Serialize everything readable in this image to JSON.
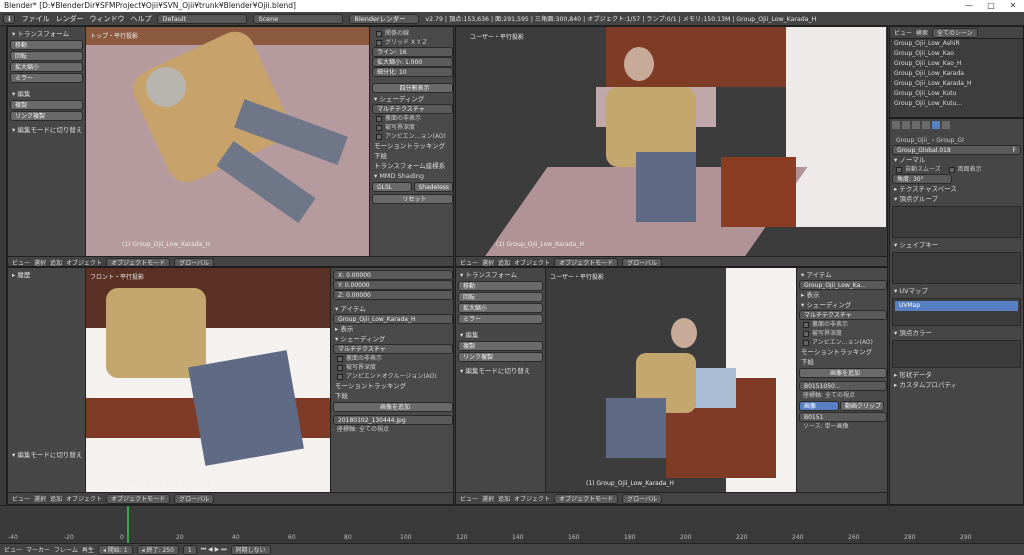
{
  "titlebar": {
    "text": "Blender* [D:¥BlenderDir¥SFMProject¥Ojii¥SVN_Ojii¥trunk¥Blender¥Ojii.blend]",
    "min": "—",
    "max": "□",
    "close": "✕"
  },
  "infobar": {
    "menus": [
      "ファイル",
      "レンダー",
      "ウィンドウ",
      "ヘルプ"
    ],
    "screen": "Default",
    "scene": "Scene",
    "engine": "Blenderレンダー",
    "stats": "v2.79 | 頂点:153,636 | 面:291,595 | 三角面:300,840 | オブジェクト:1/57 | ランプ:0/1 | メモリ:150.13M | Group_Ojii_Low_Karada_H"
  },
  "tl_view": {
    "title": "トップ・平行投影",
    "label": "(1) Group_Ojii_Low_Karada_H"
  },
  "tr_view": {
    "title": "ユーザー・平行投影",
    "label": "(1) Group_Ojii_Low_Karada_H"
  },
  "bl_view": {
    "title": "フロント・平行投影",
    "label": "(1) Group_Ojii_Low_Karada_H"
  },
  "br_view": {
    "title": "ユーザー・平行投影",
    "label": "(1) Group_Ojii_Low_Karada_H"
  },
  "tool_top": {
    "transform": "▾ トランスフォーム",
    "btns": [
      "移動",
      "回転",
      "拡大縮小",
      "ミラー"
    ],
    "edit": "▾ 編集",
    "edit_btns": [
      "複製",
      "リンク複製"
    ],
    "toggle": "▾ 編集モードに切り替え"
  },
  "tool_bl": {
    "history": "▸ 履歴",
    "toggle": "▾ 編集モードに切り替え"
  },
  "tool_br": {
    "transform": "▾ トランスフォーム",
    "btns": [
      "移動",
      "回転",
      "拡大縮小",
      "ミラー"
    ],
    "edit": "▾ 編集",
    "edit_btns": [
      "複製",
      "リンク複製"
    ],
    "toggle": "▾ 編集モードに切り替え"
  },
  "props_tl": {
    "rel": "関係の線",
    "grid": "グリッド",
    "axes": [
      "X",
      "Y",
      "Z"
    ],
    "lines_lbl": "ライン:",
    "lines": "16",
    "scale_lbl": "拡大縮小:",
    "scale": "1.000",
    "sub_lbl": "細分化:",
    "sub": "10",
    "quad": "四分割表示",
    "shading": "▾ シェーディング",
    "multi": "マルチテクスチャ",
    "backface": "裏面の非表示",
    "depth": "被写界深度",
    "ao": "アンビエン...ョン(AO)",
    "motion": "モーショントラッキング",
    "bg": "下絵",
    "transform_orient": "トランスフォーム座標系",
    "mmd": "▾ MMD Shading",
    "glsl": "GLSL",
    "shadeless": "Shadeless",
    "reset": "リセット"
  },
  "props_bl": {
    "x_lbl": "X:",
    "x": "0.00000",
    "y_lbl": "Y:",
    "y": "0.00000",
    "z_lbl": "Z:",
    "z": "0.00000",
    "item": "▾ アイテム",
    "obj": "Group_Ojii_Low_Karada_H",
    "display": "▸ 表示",
    "shading": "▾ シェーディング",
    "multi": "マルチテクスチャ",
    "backface": "裏面の非表示",
    "depth": "被写界深度",
    "ao": "アンビエントオクルージョン(AO)",
    "motion": "モーショントラッキング",
    "bg": "下絵",
    "add_img": "画像を追加",
    "img": "20180102_130444.jpg",
    "axis_lbl": "座標軸:",
    "axis": "全ての視点"
  },
  "props_br": {
    "item": "▾ アイテム",
    "obj": "Group_Ojii_Low_Ka...",
    "display": "▸ 表示",
    "shading": "▾ シェーディング",
    "multi": "マルチテクスチャ",
    "backface": "裏面の非表示",
    "depth": "被写界深度",
    "ao": "アンビエン...ョン(AO)",
    "motion": "モーショントラッキング",
    "bg": "下絵",
    "add_img": "画像を追加",
    "img": "B0151050...",
    "axis_lbl": "座標軸:",
    "axis": "全ての視点",
    "image": "画像",
    "clip": "動画クリップ",
    "img2": "B0151",
    "source": "ソース:",
    "single": "単一画像"
  },
  "viewhdr": {
    "view": "ビュー",
    "select": "選択",
    "add": "追加",
    "object": "オブジェクト",
    "mode": "オブジェクトモード",
    "global": "グローバル"
  },
  "outliner": {
    "view": "ビュー",
    "search": "検索",
    "all": "全てのシーン",
    "items": [
      "Group_Ojii_Low_AshiR",
      "Group_Ojii_Low_Kao",
      "Group_Ojii_Low_Kao_H",
      "Group_Ojii_Low_Karada",
      "Group_Ojii_Low_Karada_H",
      "Group_Ojii_Low_Kutu",
      "Group_Ojii_Low_Kutu..."
    ]
  },
  "propeditor": {
    "tab1": "Group_Ojii_",
    "tab2": "Group_Gl",
    "mesh": "Group_Global.018",
    "mesh_f": "F",
    "normal": "▾ ノーマル",
    "autosmooth": "自動スムーズ",
    "doublesided": "両面表示",
    "angle": "角度:",
    "angle_val": "30°",
    "texspace": "▸ テクスチャスペース",
    "vgroups": "▾ 頂点グループ",
    "shapekeys": "▾ シェイプキー",
    "uvmaps": "▾ UVマップ",
    "uvmap": "UVMap",
    "vcolors": "▾ 頂点カラー",
    "geom": "▸ 形状データ",
    "custom": "▸ カスタムプロパティ"
  },
  "timeline": {
    "view": "ビュー",
    "marker": "マーカー",
    "frame": "フレーム",
    "play": "再生",
    "start_lbl": "◂ 開始:",
    "start": "1",
    "end_lbl": "◂ 終了:",
    "end": "250",
    "cur": "1",
    "sync": "同期しない",
    "ticks": [
      "-40",
      "-20",
      "0",
      "20",
      "40",
      "60",
      "80",
      "100",
      "120",
      "140",
      "160",
      "180",
      "200",
      "220",
      "240",
      "260",
      "280",
      "290"
    ]
  },
  "left_tabs": [
    "ツール",
    "作成",
    "リレーション",
    "アニメ",
    "物理",
    "グリースペンシル",
    "mmd",
    "Mk"
  ]
}
